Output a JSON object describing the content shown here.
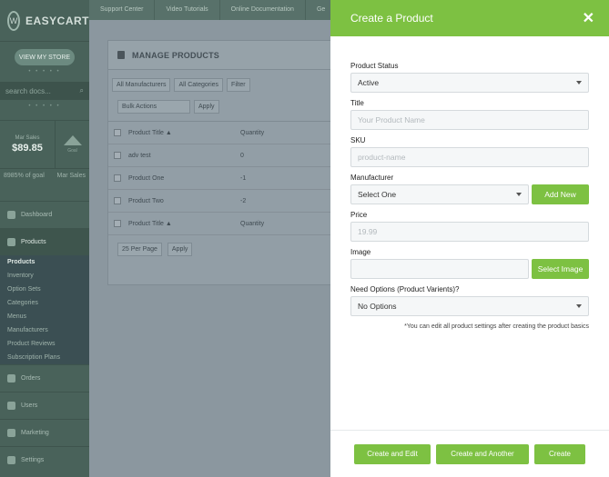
{
  "sidebar": {
    "logo_letter": "W",
    "logo_text": "EASYCART",
    "view_store": "VIEW MY STORE",
    "search_placeholder": "search docs...",
    "stat_label": "Mar Sales",
    "stat_value": "$89.85",
    "stat_right_label": "Goal",
    "goal_text": "8985% of goal",
    "goal_month": "Mar Sales",
    "nav": [
      {
        "label": "Dashboard"
      },
      {
        "label": "Products"
      },
      {
        "label": "Orders"
      },
      {
        "label": "Users"
      },
      {
        "label": "Marketing"
      },
      {
        "label": "Settings"
      }
    ],
    "subnav": [
      "Products",
      "Inventory",
      "Option Sets",
      "Categories",
      "Menus",
      "Manufacturers",
      "Product Reviews",
      "Subscription Plans"
    ]
  },
  "topnav": [
    "Support Center",
    "Video Tutorials",
    "Online Documentation",
    "Ge"
  ],
  "main": {
    "panel_title": "MANAGE PRODUCTS",
    "filter_manufacturers": "All Manufacturers",
    "filter_categories": "All Categories",
    "filter_button": "Filter",
    "bulk_actions": "Bulk Actions",
    "apply": "Apply",
    "col_title": "Product Title ▲",
    "col_quantity": "Quantity",
    "rows": [
      {
        "title": "adv test",
        "qty": "0"
      },
      {
        "title": "Product One",
        "qty": "-1"
      },
      {
        "title": "Product Two",
        "qty": "-2"
      }
    ],
    "per_page": "25 Per Page",
    "apply_bottom": "Apply"
  },
  "modal": {
    "title": "Create a Product",
    "close": "✕",
    "status_label": "Product Status",
    "status_value": "Active",
    "title_label": "Title",
    "title_placeholder": "Your Product Name",
    "sku_label": "SKU",
    "sku_placeholder": "product-name",
    "manufacturer_label": "Manufacturer",
    "manufacturer_value": "Select One",
    "add_new": "Add New",
    "price_label": "Price",
    "price_placeholder": "19.99",
    "image_label": "Image",
    "select_image": "Select Image",
    "options_label": "Need Options (Product Varients)?",
    "options_value": "No Options",
    "note": "*You can edit all product settings after creating the product basics",
    "btn_create_edit": "Create and Edit",
    "btn_create_another": "Create and Another",
    "btn_create": "Create"
  },
  "colors": {
    "accent": "#7dc142",
    "sidebar": "#49625a"
  }
}
